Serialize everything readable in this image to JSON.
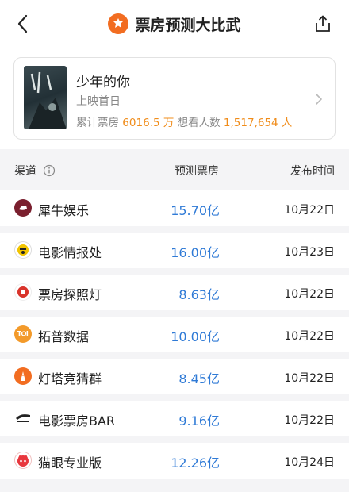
{
  "header": {
    "title": "票房预测大比武",
    "back_icon": "chevron-left-icon",
    "share_icon": "share-icon",
    "logo_icon": "cinema-logo-icon",
    "accent": "#f26d21"
  },
  "movie": {
    "title": "少年的你",
    "release": "上映首日",
    "box_label": "累计票房",
    "box_value": "6016.5 万",
    "want_label": "想看人数",
    "want_value": "1,517,654 人",
    "value_color": "#f08c1a"
  },
  "table": {
    "headers": {
      "channel": "渠道",
      "predicted": "预测票房",
      "published": "发布时间"
    },
    "info_icon": "info-icon",
    "value_color": "#2f7ad6",
    "rows": [
      {
        "name": "犀牛娱乐",
        "predicted": "15.70亿",
        "date": "10月22日",
        "logo": "rhino-logo-icon",
        "logo_color": "#7a1f2e"
      },
      {
        "name": "电影情报处",
        "predicted": "16.00亿",
        "date": "10月23日",
        "logo": "film-intel-logo-icon",
        "logo_color": "#f1c400"
      },
      {
        "name": "票房探照灯",
        "predicted": "8.63亿",
        "date": "10月22日",
        "logo": "searchlight-logo-icon",
        "logo_color": "#d9342b"
      },
      {
        "name": "拓普数据",
        "predicted": "10.00亿",
        "date": "10月22日",
        "logo": "top-data-logo-icon",
        "logo_color": "#f39a2a"
      },
      {
        "name": "灯塔竞猜群",
        "predicted": "8.45亿",
        "date": "10月22日",
        "logo": "lighthouse-logo-icon",
        "logo_color": "#f26d21"
      },
      {
        "name": "电影票房BAR",
        "predicted": "9.16亿",
        "date": "10月22日",
        "logo": "boxoffice-bar-logo-icon",
        "logo_color": "#222222"
      },
      {
        "name": "猫眼专业版",
        "predicted": "12.26亿",
        "date": "10月24日",
        "logo": "maoyan-logo-icon",
        "logo_color": "#e8363d"
      }
    ]
  }
}
